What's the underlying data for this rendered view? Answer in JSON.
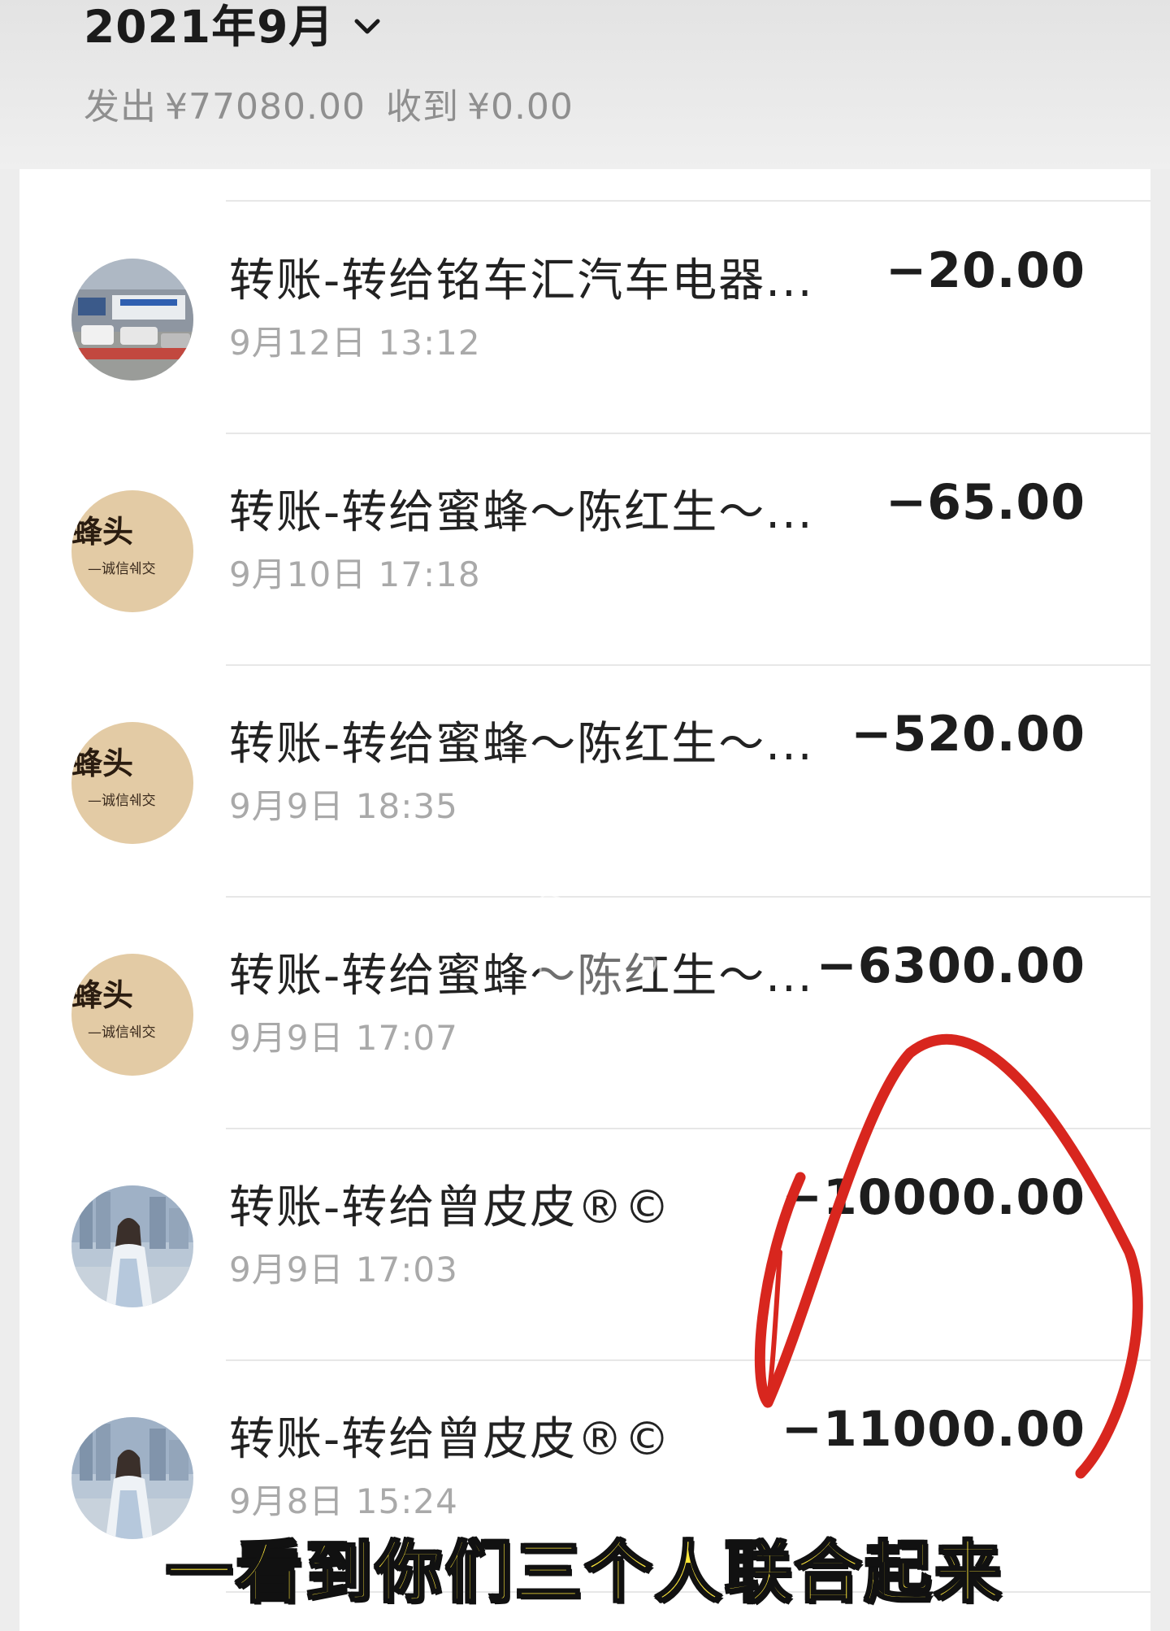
{
  "header": {
    "month": "2021年9月",
    "chevron_icon": "chevron-down-icon",
    "summary_sent_label": "发出",
    "summary_sent_amount": "¥77080.00",
    "summary_received_label": "收到",
    "summary_received_amount": "¥0.00"
  },
  "transactions": [
    {
      "title": "转账-转给铭车汇汽车电器...",
      "date": "9月12日 13:12",
      "amount": "−20.00",
      "avatar": "storefront-photo"
    },
    {
      "title": "转账-转给蜜蜂～陈红生～...",
      "date": "9月10日 17:18",
      "amount": "−65.00",
      "avatar": "calligraphy-sign"
    },
    {
      "title": "转账-转给蜜蜂～陈红生～...",
      "date": "9月9日 18:35",
      "amount": "−520.00",
      "avatar": "calligraphy-sign"
    },
    {
      "title": "转账-转给蜜蜂～陈红生～...",
      "date": "9月9日 17:07",
      "amount": "−6300.00",
      "avatar": "calligraphy-sign"
    },
    {
      "title": "转账-转给曾皮皮®©",
      "date": "9月9日 17:03",
      "amount": "−10000.00",
      "avatar": "person-photo"
    },
    {
      "title": "转账-转给曾皮皮®©",
      "date": "9月8日 15:24",
      "amount": "−11000.00",
      "avatar": "person-photo"
    }
  ],
  "avatar_text": {
    "calligraphy_main": "蜂头",
    "calligraphy_sub": "—诚信쉐交"
  },
  "overlay": {
    "play_icon": "play-icon",
    "annotation": "red-circle-annotation",
    "annotation_color": "#d8261e",
    "subtitle": "一看到你们三个人联合起来",
    "subtitle_color": "#ffe83a"
  }
}
